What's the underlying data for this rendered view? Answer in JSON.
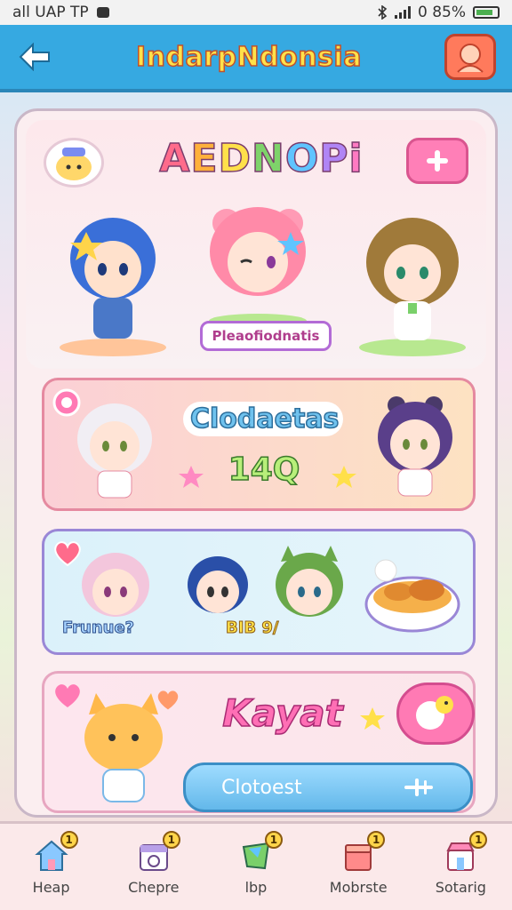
{
  "status_bar": {
    "left_text": "all UAP TP",
    "right_text": "0 85%"
  },
  "app_header": {
    "title": "IndarpNdonsia",
    "back_icon": "back-arrow-icon",
    "avatar_icon": "avatar-icon"
  },
  "hero": {
    "title_letters": [
      "A",
      "E",
      "D",
      "N",
      "O",
      "P",
      "i",
      "i"
    ],
    "title": "AEDNOPi",
    "label": "Pleaofiodnatis",
    "mascot_icon": "mascot-icon",
    "add_icon": "plus-icon"
  },
  "card1": {
    "title": "Clodaetas",
    "value": "14Q"
  },
  "card2": {
    "tag1": "Frunue?",
    "tag2": "BIB 9/"
  },
  "card3": {
    "title": "Kayat",
    "cta_label": "Clotoest"
  },
  "nav": {
    "items": [
      {
        "label": "Heap",
        "icon": "home-icon",
        "badge": "1"
      },
      {
        "label": "Chepre",
        "icon": "calendar-icon",
        "badge": "1"
      },
      {
        "label": "lbp",
        "icon": "gem-icon",
        "badge": "1"
      },
      {
        "label": "Mobrste",
        "icon": "box-icon",
        "badge": "1"
      },
      {
        "label": "Sotarig",
        "icon": "shop-icon",
        "badge": "1"
      }
    ]
  },
  "colors": {
    "header_bg": "#36a9e1",
    "accent_pink": "#ff7fb7",
    "accent_blue": "#6fc2ee"
  }
}
